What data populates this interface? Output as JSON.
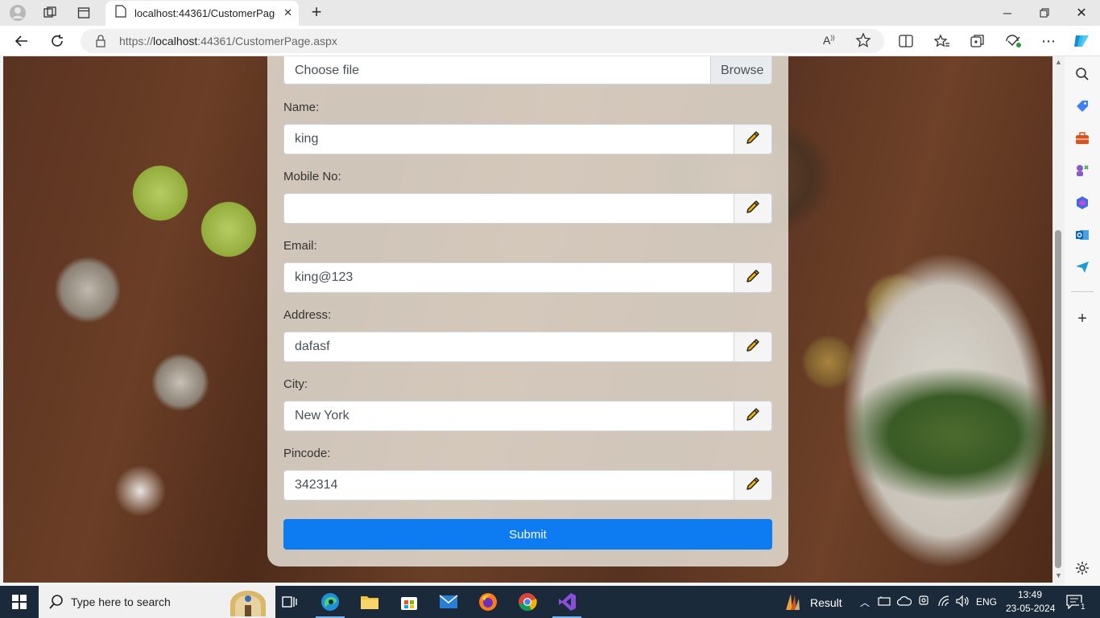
{
  "browser": {
    "tab_title": "localhost:44361/CustomerPage.a",
    "url_prefix": "https://",
    "url_host": "localhost",
    "url_rest": ":44361/CustomerPage.aspx"
  },
  "form": {
    "file_placeholder": "Choose file",
    "browse_label": "Browse",
    "name_label": "Name:",
    "name_value": "king",
    "mobile_label": "Mobile No:",
    "mobile_value": "",
    "email_label": "Email:",
    "email_value": "king@123",
    "address_label": "Address:",
    "address_value": "dafasf",
    "city_label": "City:",
    "city_value": "New York",
    "pincode_label": "Pincode:",
    "pincode_value": "342314",
    "submit_label": "Submit"
  },
  "taskbar": {
    "search_placeholder": "Type here to search",
    "result_label": "Result",
    "lang": "ENG",
    "time": "13:49",
    "date": "23-05-2024",
    "notification_count": "1"
  },
  "colors": {
    "accent": "#0d7cf2",
    "pencil": "#f2b200"
  }
}
